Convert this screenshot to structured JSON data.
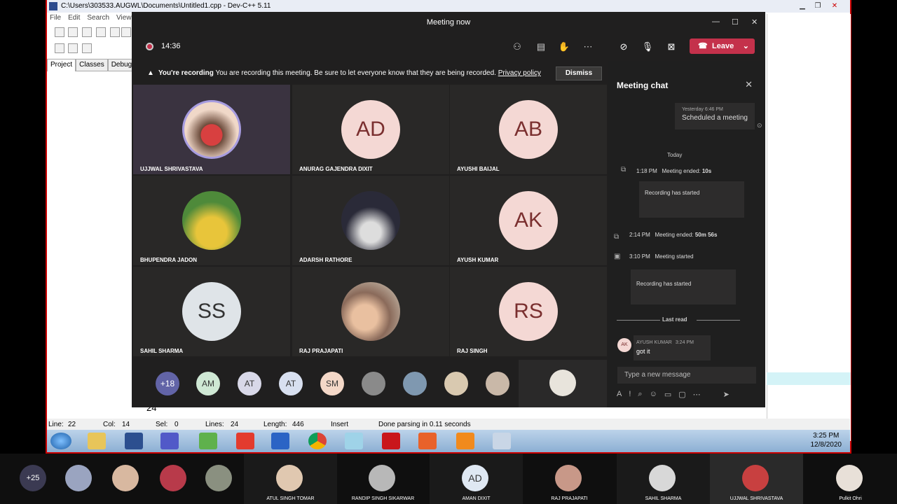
{
  "devcpp": {
    "title": "C:\\Users\\303533.AUGWL\\Documents\\Untitled1.cpp - Dev-C++ 5.11",
    "menu": [
      "File",
      "Edit",
      "Search",
      "View"
    ],
    "tabs": [
      "Project",
      "Classes",
      "Debug"
    ],
    "status": {
      "line": "Line:",
      "line_v": "22",
      "col": "Col:",
      "col_v": "14",
      "sel": "Sel:",
      "sel_v": "0",
      "lines": "Lines:",
      "lines_v": "24",
      "length": "Length:",
      "length_v": "446",
      "mode": "Insert",
      "parse": "Done parsing in 0.11 seconds"
    },
    "code_snippet": "24"
  },
  "taskbar": {
    "time": "3:25 PM",
    "date": "12/8/2020"
  },
  "teams": {
    "title": "Meeting now",
    "timer": "14:36",
    "leave": "Leave",
    "banner": {
      "bold": "You're recording",
      "text": "You are recording this meeting. Be sure to let everyone know that they are being recorded.",
      "link": "Privacy policy",
      "dismiss": "Dismiss"
    },
    "tiles": [
      {
        "name": "UJJWAL SHRIVASTAVA",
        "initials": "",
        "photo": true
      },
      {
        "name": "ANURAG GAJENDRA DIXIT",
        "initials": "AD"
      },
      {
        "name": "AYUSHI BAIJAL",
        "initials": "AB"
      },
      {
        "name": "BHUPENDRA JADON",
        "initials": "",
        "photo": true
      },
      {
        "name": "ADARSH RATHORE",
        "initials": "",
        "photo": true
      },
      {
        "name": "AYUSH KUMAR",
        "initials": "AK"
      },
      {
        "name": "SAHIL SHARMA",
        "initials": "SS"
      },
      {
        "name": "RAJ PRAJAPATI",
        "initials": "",
        "photo": true
      },
      {
        "name": "RAJ SINGH",
        "initials": "RS"
      }
    ],
    "strip": [
      "+18",
      "AM",
      "AT",
      "AT",
      "SM"
    ]
  },
  "chat": {
    "header": "Meeting chat",
    "scheduled": {
      "time": "Yesterday 6:46 PM",
      "text": "Scheduled a meeting"
    },
    "today": "Today",
    "ev1": {
      "time": "1:18 PM",
      "text": "Meeting ended:",
      "dur": "10s",
      "card": "Recording has started"
    },
    "ev2": {
      "time": "2:14 PM",
      "text": "Meeting ended:",
      "dur": "50m 56s"
    },
    "ev3": {
      "time": "3:10 PM",
      "text": "Meeting started",
      "card": "Recording has started"
    },
    "last_read": "Last read",
    "msg": {
      "initials": "AK",
      "name": "AYUSH KUMAR",
      "time": "3:24 PM",
      "text": "got it"
    },
    "placeholder": "Type a new message"
  },
  "bottom": {
    "count": "+25",
    "people": [
      {
        "name": ""
      },
      {
        "name": ""
      },
      {
        "name": ""
      },
      {
        "name": ""
      },
      {
        "name": "ATUL SINGH TOMAR"
      },
      {
        "name": "RANDIP SINGH SIKARWAR"
      },
      {
        "name": "AMAN DIXIT",
        "initials": "AD"
      },
      {
        "name": "RAJ PRAJAPATI"
      },
      {
        "name": "SAHIL SHARMA"
      },
      {
        "name": "UJJWAL SHRIVASTAVA"
      },
      {
        "name": "Pulkit Ohri"
      }
    ]
  }
}
